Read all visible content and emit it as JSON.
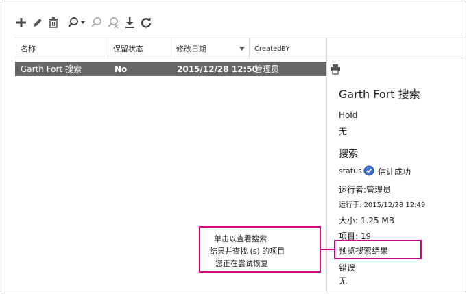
{
  "toolbar": {
    "buttons": [
      {
        "name": "add-icon"
      },
      {
        "name": "edit-icon"
      },
      {
        "name": "delete-icon"
      },
      {
        "name": "search-dropdown-icon"
      },
      {
        "name": "start-search-icon"
      },
      {
        "name": "stop-search-icon"
      },
      {
        "name": "export-icon"
      },
      {
        "name": "refresh-icon"
      }
    ]
  },
  "table": {
    "columns": [
      "名称",
      "保留状态",
      "修改日期",
      "Created",
      "BY"
    ],
    "sorted_column": "修改日期",
    "selected_row": {
      "name": "Garth Fort 搜索",
      "hold": "No",
      "modified": "2015/12/28 12:50",
      "created_by": "管理员"
    }
  },
  "details": {
    "title": "Garth Fort 搜索",
    "hold_label": "Hold",
    "hold_value": "无",
    "search_heading": "搜索",
    "status_label": "status",
    "status_value": "估计成功",
    "run_by": "运行者:管理员",
    "run_at": "运行于: 2015/12/28 12:49",
    "size": "大小: 1.25 MB",
    "items": "项目: 19",
    "preview_link": "预览搜索结果",
    "errors_label": "错误",
    "errors_value": "无"
  },
  "callout": {
    "line1": "单击以查看搜索",
    "line2": "结果并查找 (s) 的项目",
    "line3": "您正在尝试恢复"
  },
  "colors": {
    "selected_row": "#666666",
    "highlight": "#d2008a",
    "status_ok": "#3b6fd6"
  }
}
